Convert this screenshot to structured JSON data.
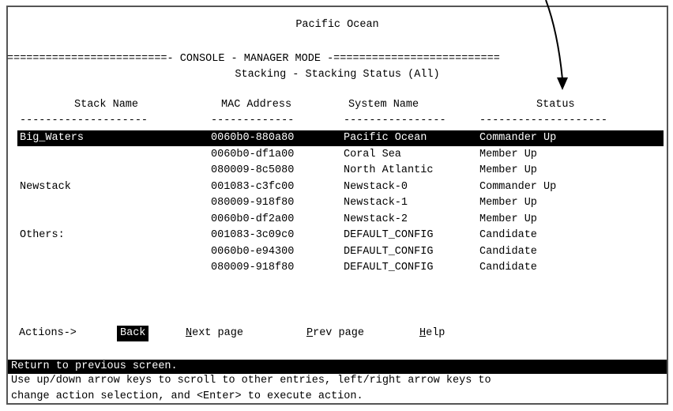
{
  "screen_title": "Pacific Ocean",
  "mode_line": "=========================- CONSOLE - MANAGER MODE -==========================",
  "subtitle": "Stacking - Stacking Status (All)",
  "columns": [
    "Stack Name",
    "MAC Address",
    "System Name",
    "Status"
  ],
  "dashes": [
    "--------------------",
    "-------------",
    "----------------",
    "--------------------"
  ],
  "rows": [
    {
      "stack": "Big_Waters",
      "mac": "0060b0-880a80",
      "system": "Pacific Ocean",
      "status": "Commander Up",
      "selected": true
    },
    {
      "stack": "",
      "mac": "0060b0-df1a00",
      "system": "Coral Sea",
      "status": "Member Up",
      "selected": false
    },
    {
      "stack": "",
      "mac": "080009-8c5080",
      "system": "North Atlantic",
      "status": "Member Up",
      "selected": false
    },
    {
      "stack": "Newstack",
      "mac": "001083-c3fc00",
      "system": "Newstack-0",
      "status": "Commander Up",
      "selected": false
    },
    {
      "stack": "",
      "mac": "080009-918f80",
      "system": "Newstack-1",
      "status": "Member Up",
      "selected": false
    },
    {
      "stack": "",
      "mac": "0060b0-df2a00",
      "system": "Newstack-2",
      "status": "Member Up",
      "selected": false
    },
    {
      "stack": "Others:",
      "mac": "001083-3c09c0",
      "system": "DEFAULT_CONFIG",
      "status": "Candidate",
      "selected": false
    },
    {
      "stack": "",
      "mac": "0060b0-e94300",
      "system": "DEFAULT_CONFIG",
      "status": "Candidate",
      "selected": false
    },
    {
      "stack": "",
      "mac": "080009-918f80",
      "system": "DEFAULT_CONFIG",
      "status": "Candidate",
      "selected": false
    }
  ],
  "actions": {
    "label": "Actions->",
    "back": "Back",
    "next_first": "N",
    "next_rest": "ext page",
    "prev_first": "P",
    "prev_rest": "rev page",
    "help_first": "H",
    "help_rest": "elp"
  },
  "status_line": "Return to previous screen.",
  "help_lines": [
    "Use up/down arrow keys to scroll to other entries, left/right arrow keys to",
    "change action selection, and <Enter> to execute action."
  ]
}
